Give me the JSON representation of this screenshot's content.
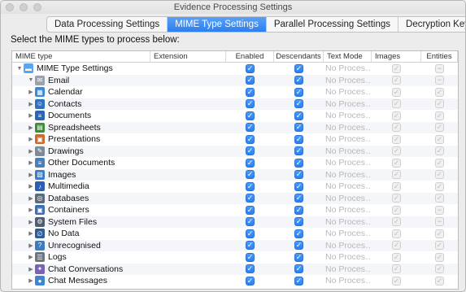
{
  "window": {
    "title": "Evidence Processing Settings"
  },
  "tabs": [
    {
      "label": "Data Processing Settings",
      "active": false
    },
    {
      "label": "MIME Type Settings",
      "active": true
    },
    {
      "label": "Parallel Processing Settings",
      "active": false
    },
    {
      "label": "Decryption Keys",
      "active": false
    }
  ],
  "prompt": "Select the MIME types to process below:",
  "columns": [
    "MIME type",
    "Extension",
    "Enabled",
    "Descendants",
    "Text Mode",
    "Images",
    "Entities"
  ],
  "text_mode_value": "No Proces…",
  "rows": [
    {
      "label": "MIME Type Settings",
      "icon": "folder-icon",
      "color": "#59a6f0",
      "level": 0,
      "expanded": true,
      "entities": "dash"
    },
    {
      "label": "Email",
      "icon": "envelope-icon",
      "color": "#9aa3ad",
      "level": 1,
      "expanded": true,
      "entities": "dash"
    },
    {
      "label": "Calendar",
      "icon": "calendar-icon",
      "color": "#3a88d8",
      "level": 1,
      "expanded": false,
      "entities": "check"
    },
    {
      "label": "Contacts",
      "icon": "contacts-icon",
      "color": "#2f6fc2",
      "level": 1,
      "expanded": false,
      "entities": "check"
    },
    {
      "label": "Documents",
      "icon": "documents-icon",
      "color": "#2b65b8",
      "level": 1,
      "expanded": false,
      "entities": "check"
    },
    {
      "label": "Spreadsheets",
      "icon": "spreadsheet-icon",
      "color": "#3f8b3a",
      "level": 1,
      "expanded": false,
      "entities": "check"
    },
    {
      "label": "Presentations",
      "icon": "presentation-icon",
      "color": "#d06a2a",
      "level": 1,
      "expanded": false,
      "entities": "check"
    },
    {
      "label": "Drawings",
      "icon": "drawing-icon",
      "color": "#7d8a99",
      "level": 1,
      "expanded": false,
      "entities": "check"
    },
    {
      "label": "Other Documents",
      "icon": "other-documents-icon",
      "color": "#4a7fb8",
      "level": 1,
      "expanded": false,
      "entities": "check"
    },
    {
      "label": "Images",
      "icon": "image-icon",
      "color": "#3a7cc9",
      "level": 1,
      "expanded": false,
      "entities": "check"
    },
    {
      "label": "Multimedia",
      "icon": "multimedia-icon",
      "color": "#2d5fae",
      "level": 1,
      "expanded": false,
      "entities": "check"
    },
    {
      "label": "Databases",
      "icon": "database-icon",
      "color": "#5d6b7a",
      "level": 1,
      "expanded": false,
      "entities": "check"
    },
    {
      "label": "Containers",
      "icon": "container-icon",
      "color": "#3b6fb3",
      "level": 1,
      "expanded": false,
      "entities": "dash"
    },
    {
      "label": "System Files",
      "icon": "system-files-icon",
      "color": "#4f5e70",
      "level": 1,
      "expanded": false,
      "entities": "dash"
    },
    {
      "label": "No Data",
      "icon": "no-data-icon",
      "color": "#2f5d9a",
      "level": 1,
      "expanded": false,
      "entities": "check"
    },
    {
      "label": "Unrecognised",
      "icon": "unrecognised-icon",
      "color": "#3e7cc0",
      "level": 1,
      "expanded": false,
      "entities": "check"
    },
    {
      "label": "Logs",
      "icon": "logs-icon",
      "color": "#6b7683",
      "level": 1,
      "expanded": false,
      "entities": "check"
    },
    {
      "label": "Chat Conversations",
      "icon": "chat-conversations-icon",
      "color": "#7a63b5",
      "level": 1,
      "expanded": false,
      "entities": "check"
    },
    {
      "label": "Chat Messages",
      "icon": "chat-messages-icon",
      "color": "#3f86d0",
      "level": 1,
      "expanded": false,
      "entities": "check"
    }
  ]
}
